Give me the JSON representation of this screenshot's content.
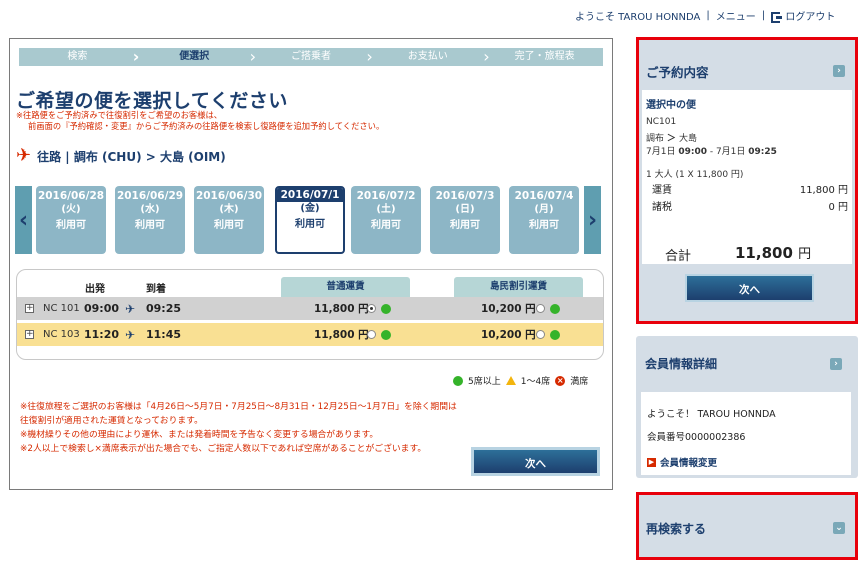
{
  "topbar": {
    "welcome": "ようこそ TAROU HONNDA",
    "menu": "メニュー",
    "logout": "ログアウト"
  },
  "steps": [
    "検索",
    "便選択",
    "ご搭乗者",
    "お支払い",
    "完了・旅程表"
  ],
  "page_title": "ご希望の便を選択してください",
  "notice_lines": [
    "※往路便をご予約済みで往復割引をご希望のお客様は、",
    "前画面の『予約確認・変更』からご予約済みの往路便を検索し復路便を追加予約してください。"
  ],
  "route": "往路 | 調布 (CHU) > 大島 (OIM)",
  "dates": [
    {
      "date": "2016/06/28",
      "dow": "(火)",
      "status": "利用可"
    },
    {
      "date": "2016/06/29",
      "dow": "(水)",
      "status": "利用可"
    },
    {
      "date": "2016/06/30",
      "dow": "(木)",
      "status": "利用可"
    },
    {
      "date": "2016/07/1",
      "dow": "(金)",
      "status": "利用可"
    },
    {
      "date": "2016/07/2",
      "dow": "(土)",
      "status": "利用可"
    },
    {
      "date": "2016/07/3",
      "dow": "(日)",
      "status": "利用可"
    },
    {
      "date": "2016/07/4",
      "dow": "(月)",
      "status": "利用可"
    }
  ],
  "flights_header": {
    "depart": "出発",
    "arrive": "到着",
    "fare_normal": "普通運賃",
    "fare_islander": "島民割引運賃"
  },
  "flights": [
    {
      "no": "NC 101",
      "dep": "09:00",
      "arr": "09:25",
      "normal": "11,800 円",
      "islander": "10,200 円"
    },
    {
      "no": "NC 103",
      "dep": "11:20",
      "arr": "11:45",
      "normal": "11,800 円",
      "islander": "10,200 円"
    }
  ],
  "legend": {
    "green": "5席以上",
    "yellow": "1〜4席",
    "red": "満席"
  },
  "foot_notes": [
    "※往復旅程をご選択のお客様は「4月26日〜5月7日・7月25日〜8月31日・12月25日〜1月7日」を除く期間は",
    "往復割引が適用された運賃となっております。",
    "※機材繰りその他の理由により運休、または発着時間を予告なく変更する場合があります。",
    "※2人以上で検索し×満席表示が出た場合でも、ご指定人数以下であれば空席があることがございます。"
  ],
  "next_label": "次へ",
  "reservation": {
    "header": "ご予約内容",
    "selected_title": "選択中の便",
    "flight_no": "NC101",
    "route_from": "調布",
    "route_to": "大島",
    "time_line_a": "7月1日 ",
    "time_a": "09:00",
    "time_line_b": " - 7月1日 ",
    "time_b": "09:25",
    "pax": "1 大人 (1 X 11,800 円)",
    "fare_label": "運賃",
    "fare_value": "11,800 円",
    "tax_label": "諸税",
    "tax_value": "0 円",
    "total_label": "合計",
    "total_value": "11,800",
    "total_unit": "円",
    "next": "次へ"
  },
  "member": {
    "header": "会員情報詳細",
    "welcome": "ようこそ！ TAROU HONNDA",
    "number": "会員番号0000002386",
    "change_link": "会員情報変更"
  },
  "research": {
    "header": "再検索する"
  },
  "colors": {
    "navy": "#1d3f6e",
    "red_notice": "#d62a00",
    "highlight_row": "#f9e093",
    "selected_frame": "#e8000b",
    "seat_green": "#35b32a"
  }
}
